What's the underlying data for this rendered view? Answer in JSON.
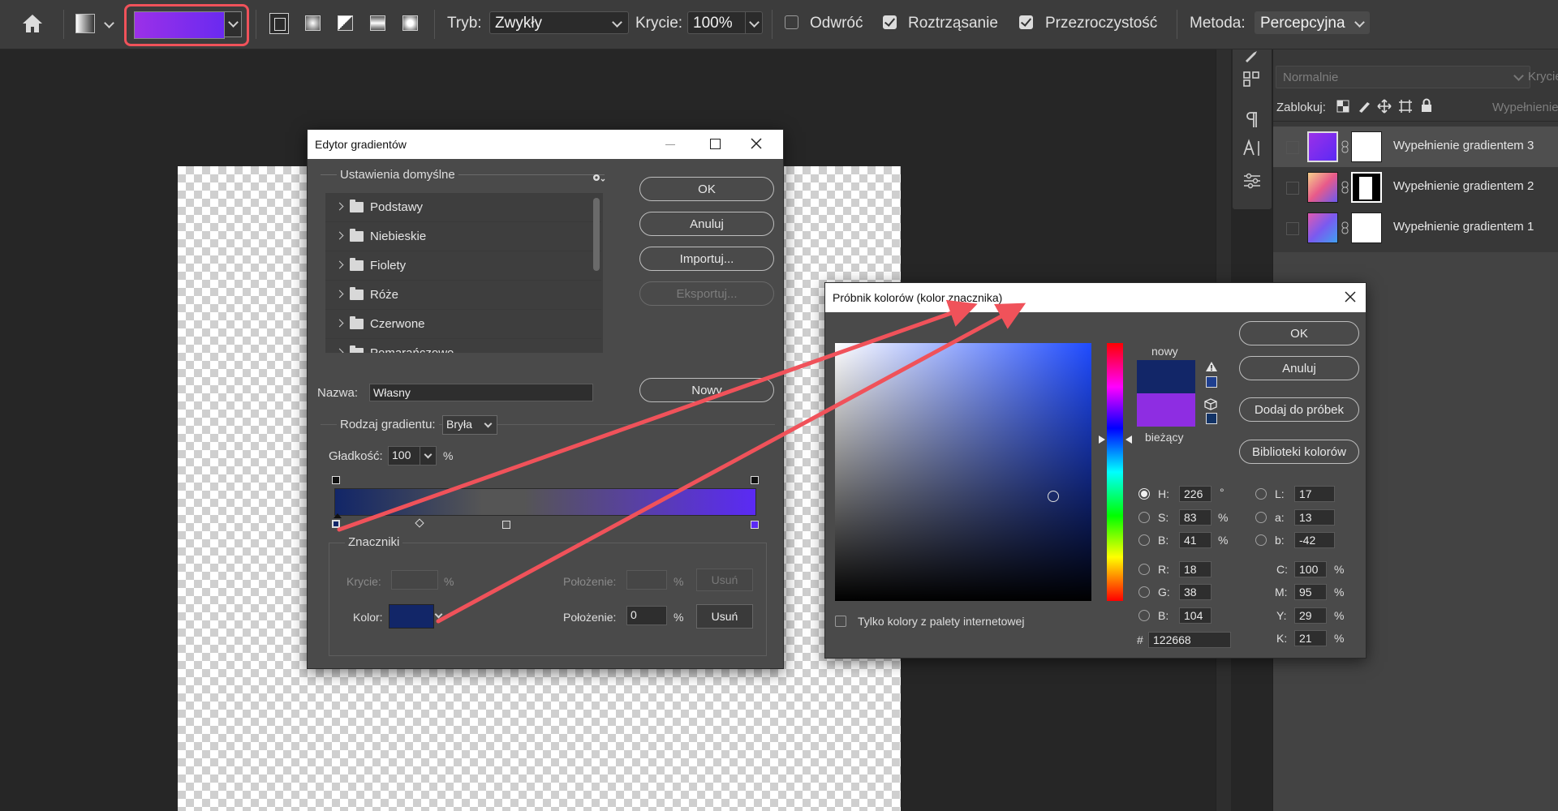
{
  "options_bar": {
    "gradient_preview": {
      "start": "#9b30e8",
      "end": "#6a2af0"
    },
    "mode_label": "Tryb:",
    "mode_value": "Zwykły",
    "opacity_label": "Krycie:",
    "opacity_value": "100%",
    "reverse_label": "Odwróć",
    "dither_label": "Roztrząsanie",
    "transparency_label": "Przezroczystość",
    "method_label": "Metoda:",
    "method_value": "Percepcyjna",
    "checkboxes": {
      "reverse": false,
      "dither": true,
      "transparency": true
    }
  },
  "layers_panel": {
    "blend_mode": "Normalnie",
    "opacity_label": "Krycie",
    "lock_label": "Zablokuj:",
    "fill_label": "Wypełnienie",
    "layers": [
      {
        "name": "Wypełnienie gradientem 3",
        "selected": true
      },
      {
        "name": "Wypełnienie gradientem 2",
        "selected": false
      },
      {
        "name": "Wypełnienie gradientem 1",
        "selected": false
      }
    ]
  },
  "gradient_editor": {
    "title": "Edytor gradientów",
    "presets_header": "Ustawienia domyślne",
    "folders": [
      "Podstawy",
      "Niebieskie",
      "Fiolety",
      "Róże",
      "Czerwone",
      "Pomarańczowe"
    ],
    "buttons": {
      "ok": "OK",
      "cancel": "Anuluj",
      "import": "Importuj...",
      "export": "Eksportuj...",
      "new": "Nowy"
    },
    "name_label": "Nazwa:",
    "name_value": "Własny",
    "type_label": "Rodzaj gradientu:",
    "type_value": "Bryła",
    "smoothness_label": "Gładkość:",
    "smoothness_value": "100",
    "percent": "%",
    "stops_header": "Znaczniki",
    "opacity_label": "Krycie:",
    "location_label": "Położenie:",
    "location_value": "0",
    "delete_label": "Usuń",
    "color_label": "Kolor:",
    "stop_color": "#122668",
    "bar_colors": {
      "start": "#122668",
      "mid": "#555555",
      "end": "#5b2af5"
    }
  },
  "color_picker": {
    "title": "Próbnik kolorów (kolor znacznika)",
    "new_label": "nowy",
    "current_label": "bieżący",
    "new_color": "#122668",
    "current_color": "#8e2de2",
    "buttons": {
      "ok": "OK",
      "cancel": "Anuluj",
      "add_swatch": "Dodaj do próbek",
      "libraries": "Biblioteki kolorów"
    },
    "web_only_label": "Tylko kolory z palety internetowej",
    "hsb": {
      "h_label": "H:",
      "h": "226",
      "h_unit": "°",
      "s_label": "S:",
      "s": "83",
      "b_label": "B:",
      "b": "41",
      "unit": "%"
    },
    "rgb": {
      "r_label": "R:",
      "r": "18",
      "g_label": "G:",
      "g": "38",
      "b_label": "B:",
      "b": "104"
    },
    "lab": {
      "l_label": "L:",
      "l": "17",
      "a_label": "a:",
      "a": "13",
      "b_label": "b:",
      "b": "-42"
    },
    "cmyk": {
      "c_label": "C:",
      "c": "100",
      "m_label": "M:",
      "m": "95",
      "y_label": "Y:",
      "y": "29",
      "k_label": "K:",
      "k": "21",
      "unit": "%"
    },
    "hex_label": "#",
    "hex": "122668"
  },
  "annotations": {
    "color": "#f0525a"
  }
}
